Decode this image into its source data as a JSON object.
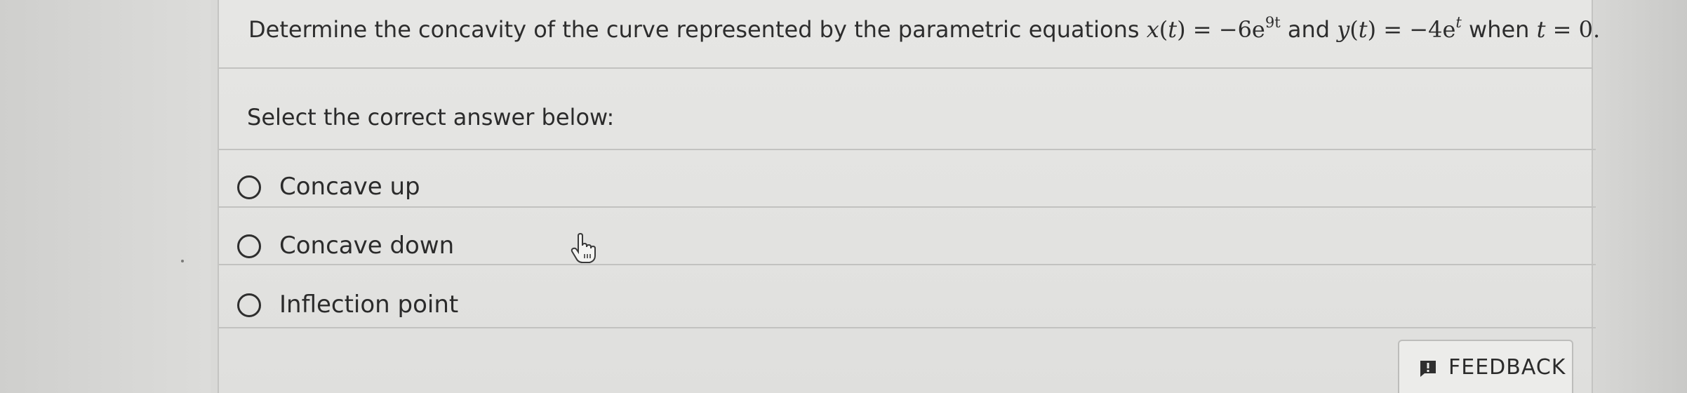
{
  "question": {
    "prefix": "Determine the concavity of the curve represented by the parametric equations ",
    "x_lhs": "x",
    "x_var": "t",
    "x_rhs": "−6e",
    "x_exp": "9t",
    "connector": "and",
    "y_lhs": "y",
    "y_var": "t",
    "y_rhs": "−4e",
    "y_exp": "t",
    "when": "when",
    "t_var": "t",
    "t_value": "0"
  },
  "prompt": "Select the correct answer below:",
  "options": [
    {
      "label": "Concave up"
    },
    {
      "label": "Concave down"
    },
    {
      "label": "Inflection point"
    }
  ],
  "feedback": {
    "label": "FEEDBACK",
    "icon": "exclamation-speech-icon"
  },
  "cursor": {
    "icon": "hand-pointer-icon"
  }
}
